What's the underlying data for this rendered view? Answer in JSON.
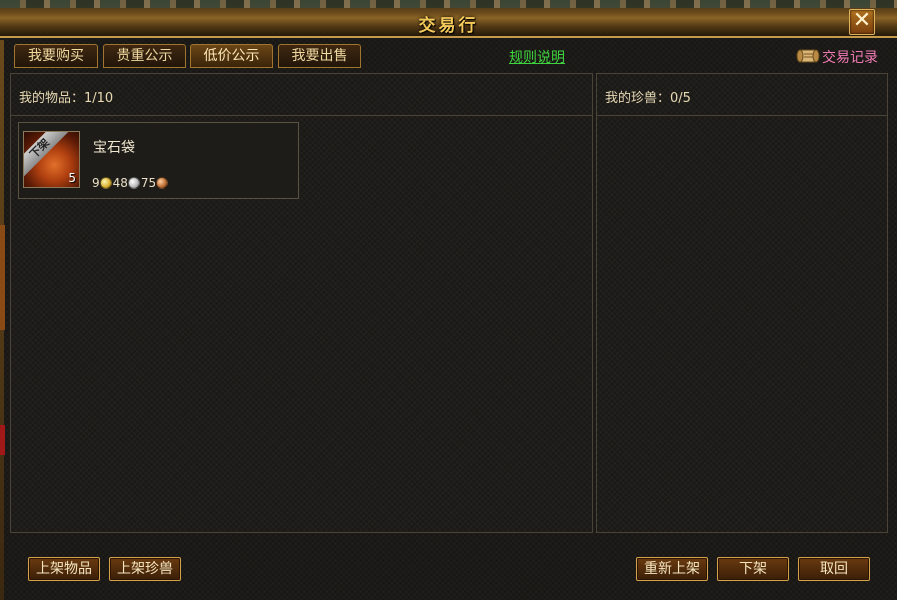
{
  "window": {
    "title": "交易行",
    "close_icon": "close-icon"
  },
  "tabs": [
    {
      "label": "我要购买",
      "active": false
    },
    {
      "label": "贵重公示",
      "active": false
    },
    {
      "label": "低价公示",
      "active": true
    },
    {
      "label": "我要出售",
      "active": false
    }
  ],
  "rules_link": "规则说明",
  "trade_record": {
    "label": "交易记录",
    "icon": "scroll-icon",
    "color": "#f07ab4"
  },
  "my_items": {
    "header": "我的物品：1/10",
    "items": [
      {
        "name": "宝石袋",
        "badge": "下架",
        "count": "5",
        "icon": "gem-bag-icon",
        "price": {
          "gold": "9",
          "silver": "48",
          "copper": "75"
        }
      }
    ]
  },
  "my_pets": {
    "header": "我的珍兽：0/5"
  },
  "bottom_buttons": {
    "list_item": "上架物品",
    "list_pet": "上架珍兽",
    "relist": "重新上架",
    "delist": "下架",
    "cancel": "取回"
  },
  "colors": {
    "title": "#f4c95a",
    "rules_link": "#3fd43f",
    "border_gold": "#d4a24a"
  }
}
